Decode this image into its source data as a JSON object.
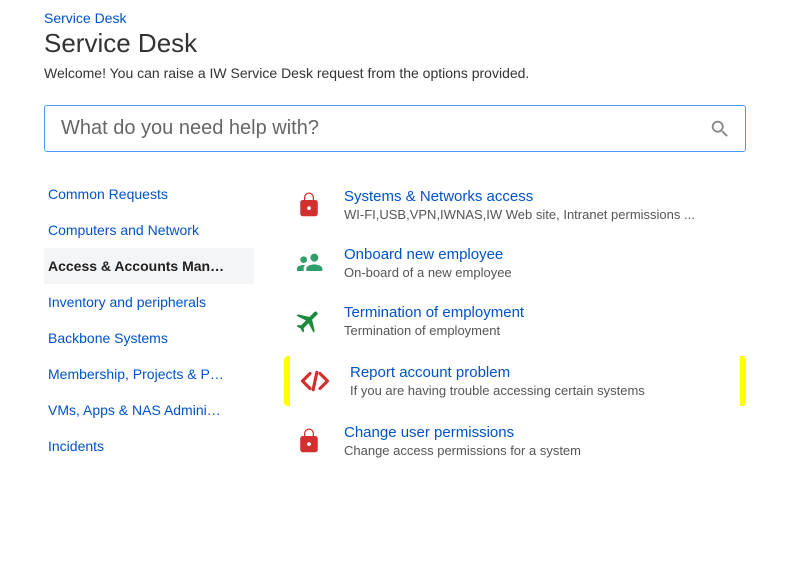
{
  "breadcrumb": {
    "root": "Service Desk"
  },
  "title": "Service Desk",
  "welcome": "Welcome! You can raise a IW Service Desk request from the options provided.",
  "search": {
    "placeholder": "What do you need help with?"
  },
  "sidebar": {
    "items": [
      {
        "label": "Common Requests",
        "active": false
      },
      {
        "label": "Computers and Network",
        "active": false
      },
      {
        "label": "Access & Accounts Man…",
        "active": true
      },
      {
        "label": "Inventory and peripherals",
        "active": false
      },
      {
        "label": "Backbone Systems",
        "active": false
      },
      {
        "label": "Membership, Projects & P…",
        "active": false
      },
      {
        "label": "VMs, Apps & NAS Admini…",
        "active": false
      },
      {
        "label": "Incidents",
        "active": false
      }
    ]
  },
  "requests": [
    {
      "icon": "lock-icon",
      "title": "Systems & Networks access",
      "desc": "WI-FI,USB,VPN,IWNAS,IW Web site, Intranet permissions ...",
      "highlight": false
    },
    {
      "icon": "people-icon",
      "title": "Onboard new employee",
      "desc": "On-board of a new employee",
      "highlight": false
    },
    {
      "icon": "plane-icon",
      "title": "Termination of employment",
      "desc": "Termination of employment",
      "highlight": false
    },
    {
      "icon": "code-icon",
      "title": "Report account problem",
      "desc": "If you are having trouble accessing certain systems",
      "highlight": true
    },
    {
      "icon": "lock-icon",
      "title": "Change user permissions",
      "desc": "Change access permissions for a system",
      "highlight": false
    }
  ]
}
